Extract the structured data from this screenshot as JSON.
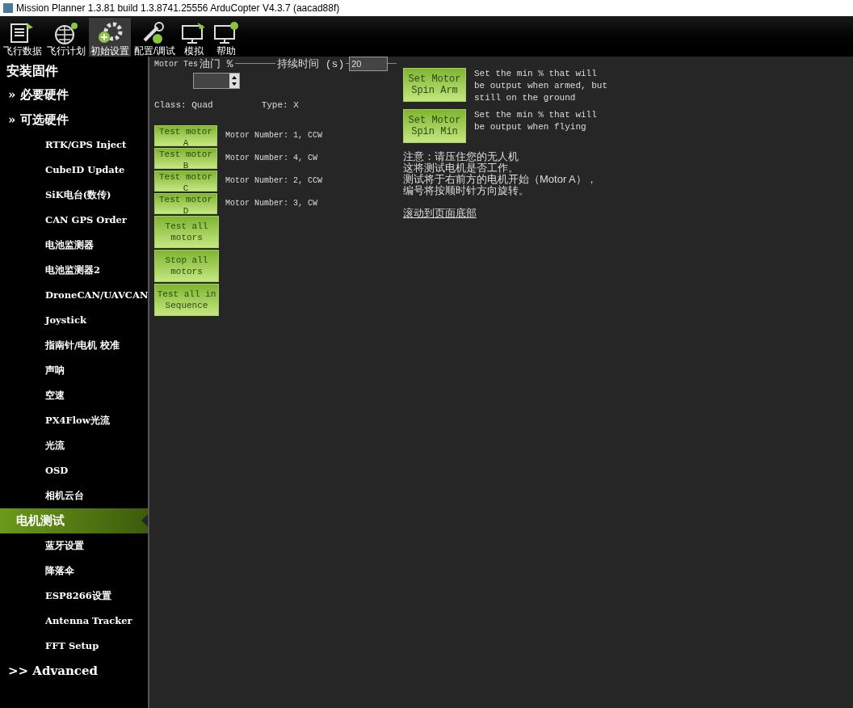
{
  "window": {
    "title": "Mission Planner 1.3.81 build 1.3.8741.25556 ArduCopter V4.3.7 (aacad88f)"
  },
  "toolbar": [
    {
      "label": "飞行数据",
      "kind": "data",
      "selected": false
    },
    {
      "label": "飞行计划",
      "kind": "plan",
      "selected": false
    },
    {
      "label": "初始设置",
      "kind": "setup",
      "selected": true
    },
    {
      "label": "配置/调试",
      "kind": "config",
      "selected": false
    },
    {
      "label": "模拟",
      "kind": "sim",
      "selected": false
    },
    {
      "label": "帮助",
      "kind": "help",
      "selected": false
    }
  ],
  "sidebar": {
    "items": [
      {
        "label": "安装固件",
        "kind": "top",
        "selected": false
      },
      {
        "label": "» 必要硬件",
        "kind": "section",
        "selected": false
      },
      {
        "label": "» 可选硬件",
        "kind": "section",
        "selected": false,
        "children": [
          {
            "label": "RTK/GPS Inject",
            "selected": false
          },
          {
            "label": "CubeID Update",
            "selected": false
          },
          {
            "label": "SiK电台(数传)",
            "selected": false
          },
          {
            "label": "CAN GPS Order",
            "selected": false
          },
          {
            "label": "电池监测器",
            "selected": false
          },
          {
            "label": "电池监测器2",
            "selected": false
          },
          {
            "label": "DroneCAN/UAVCAN",
            "selected": false
          },
          {
            "label": "Joystick",
            "selected": false
          },
          {
            "label": "指南针/电机 校准",
            "selected": false
          },
          {
            "label": "声呐",
            "selected": false
          },
          {
            "label": "空速",
            "selected": false
          },
          {
            "label": "PX4Flow光流",
            "selected": false
          },
          {
            "label": "光流",
            "selected": false
          },
          {
            "label": "OSD",
            "selected": false
          },
          {
            "label": "相机云台",
            "selected": false
          },
          {
            "label": "电机测试",
            "selected": true
          },
          {
            "label": "蓝牙设置",
            "selected": false
          },
          {
            "label": "降落伞",
            "selected": false
          },
          {
            "label": "ESP8266设置",
            "selected": false
          },
          {
            "label": "Antenna Tracker",
            "selected": false
          },
          {
            "label": "FFT Setup",
            "selected": false
          }
        ]
      },
      {
        "label": ">> Advanced",
        "kind": "section",
        "selected": false
      }
    ]
  },
  "motor_test": {
    "group_title": "Motor Tes",
    "throttle_label": "油门 %",
    "duration_label": "持续时间 (s)",
    "duration_value": "20",
    "class": "Class: Quad",
    "type": "Type: X",
    "motors": [
      {
        "button": "Test motor A",
        "info": "Motor Number: 1, CCW"
      },
      {
        "button": "Test motor B",
        "info": "Motor Number: 4, CW"
      },
      {
        "button": "Test motor C",
        "info": "Motor Number: 2, CCW"
      },
      {
        "button": "Test motor D",
        "info": "Motor Number: 3, CW"
      }
    ],
    "buttons": [
      "Test all motors",
      "Stop all motors",
      "Test all in Sequence"
    ],
    "spin": [
      {
        "button": "Set Motor Spin Arm",
        "note": "Set the min % that will be output when armed, but still on the ground"
      },
      {
        "button": "Set Motor Spin Min",
        "note": "Set the min % that will be output when flying"
      }
    ],
    "notice": [
      "注意：请压住您的无人机",
      "这将测试电机是否工作。",
      "测试将于右前方的电机开始（Motor A），",
      "编号将按顺时针方向旋转。"
    ],
    "link": "滚动到页面底部"
  }
}
